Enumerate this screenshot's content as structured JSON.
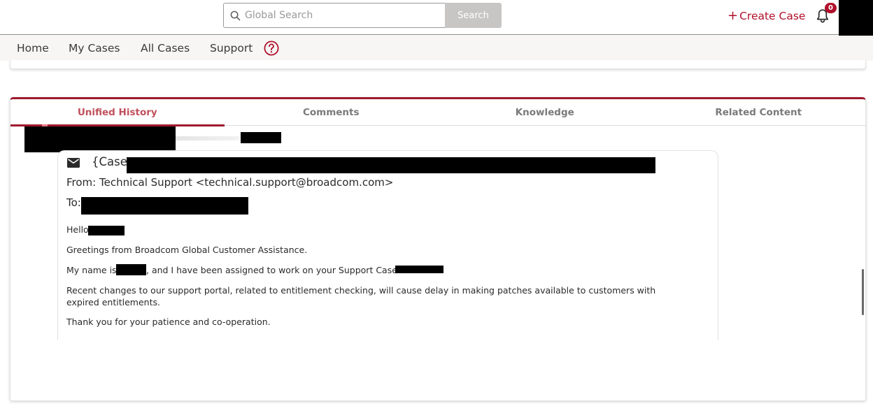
{
  "header": {
    "search": {
      "placeholder": "Global Search",
      "button_label": "Search"
    },
    "create_case_label": "Create Case",
    "create_case_plus": "+",
    "notifications_count": "0"
  },
  "nav": {
    "items": [
      "Home",
      "My Cases",
      "All Cases",
      "Support"
    ]
  },
  "tabs": [
    {
      "label": "Unified History",
      "active": true
    },
    {
      "label": "Comments",
      "active": false
    },
    {
      "label": "Knowledge",
      "active": false
    },
    {
      "label": "Related Content",
      "active": false
    }
  ],
  "email": {
    "subject_prefix": "{Case",
    "from": "From: Technical Support <technical.support@broadcom.com>",
    "to_label": "To:",
    "body": {
      "hello": "Hello",
      "greeting": "Greetings from Broadcom Global Customer Assistance.",
      "name_prefix": "My name is",
      "name_suffix": ", and I have been assigned to work on your Support Case #",
      "notice": "Recent changes to our support portal, related to entitlement checking, will cause delay in making patches available to customers with expired entitlements.",
      "thanks": "Thank you for your patience and co-operation."
    }
  },
  "colors": {
    "brand": "#9e1a2e",
    "accent_text": "#b0102b",
    "active_tab_text": "#c0505c",
    "search_button": "#c8c6c4"
  },
  "icons": {
    "search": "search-icon",
    "bell": "bell-icon",
    "help": "help-icon",
    "mail": "envelope-icon"
  }
}
